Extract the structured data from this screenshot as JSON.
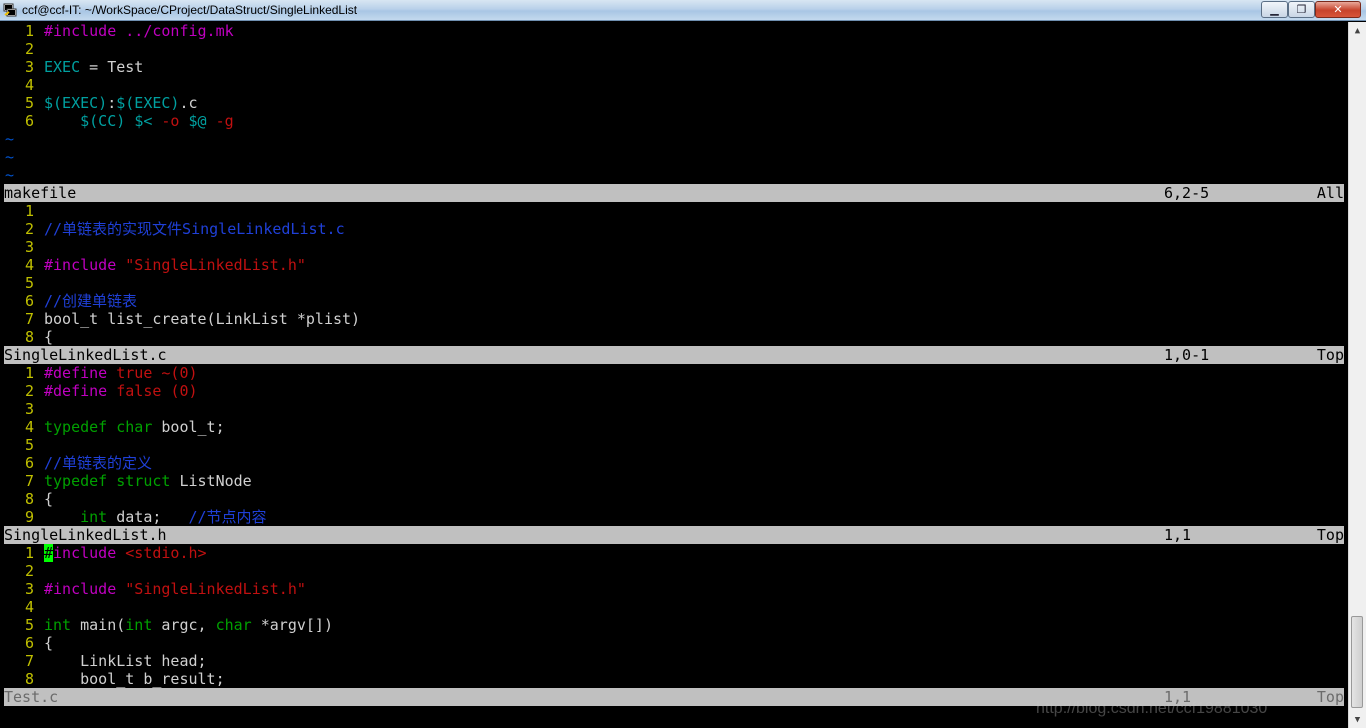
{
  "window": {
    "title": "ccf@ccf-IT: ~/WorkSpace/CProject/DataStruct/SingleLinkedList",
    "minimize_label": "▁",
    "maximize_label": "❐",
    "close_label": "✕",
    "app_icon": "putty-terminal-icon"
  },
  "panes": [
    {
      "lines": [
        {
          "num": "1",
          "segs": [
            {
              "t": "#include ../config.mk",
              "c": "pre"
            }
          ]
        },
        {
          "num": "2",
          "segs": []
        },
        {
          "num": "3",
          "segs": [
            {
              "t": "EXEC",
              "c": "var"
            },
            {
              "t": " = Test",
              "c": "nrm"
            }
          ]
        },
        {
          "num": "4",
          "segs": []
        },
        {
          "num": "5",
          "segs": [
            {
              "t": "$(EXEC)",
              "c": "var"
            },
            {
              "t": ":",
              "c": "nrm"
            },
            {
              "t": "$(EXEC)",
              "c": "var"
            },
            {
              "t": ".c",
              "c": "nrm"
            }
          ]
        },
        {
          "num": "6",
          "segs": [
            {
              "t": "    ",
              "c": "nrm"
            },
            {
              "t": "$(CC)",
              "c": "var"
            },
            {
              "t": " ",
              "c": "nrm"
            },
            {
              "t": "$<",
              "c": "var"
            },
            {
              "t": " ",
              "c": "nrm"
            },
            {
              "t": "-o",
              "c": "str"
            },
            {
              "t": " ",
              "c": "nrm"
            },
            {
              "t": "$@",
              "c": "var"
            },
            {
              "t": " ",
              "c": "nrm"
            },
            {
              "t": "-g",
              "c": "str"
            }
          ]
        }
      ],
      "tildes": 3,
      "status": {
        "name": "makefile",
        "pos": "6,2-5",
        "pct": "All",
        "active": true
      }
    },
    {
      "lines": [
        {
          "num": "1",
          "segs": []
        },
        {
          "num": "2",
          "segs": [
            {
              "t": "//单链表的实现文件SingleLinkedList.c",
              "c": "cmt"
            }
          ]
        },
        {
          "num": "3",
          "segs": []
        },
        {
          "num": "4",
          "segs": [
            {
              "t": "#include ",
              "c": "pre"
            },
            {
              "t": "\"SingleLinkedList.h\"",
              "c": "str"
            }
          ]
        },
        {
          "num": "5",
          "segs": []
        },
        {
          "num": "6",
          "segs": [
            {
              "t": "//创建单链表",
              "c": "cmt"
            }
          ]
        },
        {
          "num": "7",
          "segs": [
            {
              "t": "bool_t list_create(LinkList *plist)",
              "c": "nrm"
            }
          ]
        },
        {
          "num": "8",
          "segs": [
            {
              "t": "{",
              "c": "nrm"
            }
          ]
        }
      ],
      "tildes": 0,
      "status": {
        "name": "SingleLinkedList.c",
        "pos": "1,0-1",
        "pct": "Top",
        "active": true
      }
    },
    {
      "lines": [
        {
          "num": "1",
          "segs": [
            {
              "t": "#define ",
              "c": "pre"
            },
            {
              "t": "true",
              "c": "str"
            },
            {
              "t": " ",
              "c": "nrm"
            },
            {
              "t": "~(0)",
              "c": "str"
            }
          ]
        },
        {
          "num": "2",
          "segs": [
            {
              "t": "#define ",
              "c": "pre"
            },
            {
              "t": "false",
              "c": "str"
            },
            {
              "t": " ",
              "c": "nrm"
            },
            {
              "t": "(0)",
              "c": "str"
            }
          ]
        },
        {
          "num": "3",
          "segs": []
        },
        {
          "num": "4",
          "segs": [
            {
              "t": "typedef",
              "c": "type"
            },
            {
              "t": " ",
              "c": "nrm"
            },
            {
              "t": "char",
              "c": "type"
            },
            {
              "t": " bool_t;",
              "c": "nrm"
            }
          ]
        },
        {
          "num": "5",
          "segs": []
        },
        {
          "num": "6",
          "segs": [
            {
              "t": "//单链表的定义",
              "c": "cmt"
            }
          ]
        },
        {
          "num": "7",
          "segs": [
            {
              "t": "typedef",
              "c": "type"
            },
            {
              "t": " ",
              "c": "nrm"
            },
            {
              "t": "struct",
              "c": "type"
            },
            {
              "t": " ListNode",
              "c": "nrm"
            }
          ]
        },
        {
          "num": "8",
          "segs": [
            {
              "t": "{",
              "c": "nrm"
            }
          ]
        },
        {
          "num": "9",
          "segs": [
            {
              "t": "    ",
              "c": "nrm"
            },
            {
              "t": "int",
              "c": "type"
            },
            {
              "t": " data;   ",
              "c": "nrm"
            },
            {
              "t": "//节点内容",
              "c": "cmt"
            }
          ]
        }
      ],
      "tildes": 0,
      "status": {
        "name": "SingleLinkedList.h",
        "pos": "1,1",
        "pct": "Top",
        "active": true
      }
    },
    {
      "lines": [
        {
          "num": "1",
          "segs": [
            {
              "t": "#",
              "c": "cursor"
            },
            {
              "t": "include ",
              "c": "pre"
            },
            {
              "t": "<stdio.h>",
              "c": "str"
            }
          ]
        },
        {
          "num": "2",
          "segs": []
        },
        {
          "num": "3",
          "segs": [
            {
              "t": "#include ",
              "c": "pre"
            },
            {
              "t": "\"SingleLinkedList.h\"",
              "c": "str"
            }
          ]
        },
        {
          "num": "4",
          "segs": []
        },
        {
          "num": "5",
          "segs": [
            {
              "t": "int",
              "c": "type"
            },
            {
              "t": " main(",
              "c": "nrm"
            },
            {
              "t": "int",
              "c": "type"
            },
            {
              "t": " argc, ",
              "c": "nrm"
            },
            {
              "t": "char",
              "c": "type"
            },
            {
              "t": " *argv[])",
              "c": "nrm"
            }
          ]
        },
        {
          "num": "6",
          "segs": [
            {
              "t": "{",
              "c": "nrm"
            }
          ]
        },
        {
          "num": "7",
          "segs": [
            {
              "t": "    LinkList head;",
              "c": "nrm"
            }
          ]
        },
        {
          "num": "8",
          "segs": [
            {
              "t": "    bool_t b_result;",
              "c": "nrm"
            }
          ]
        }
      ],
      "tildes": 0,
      "status": {
        "name": "Test.c",
        "pos": "1,1",
        "pct": "Top",
        "active": false
      }
    }
  ],
  "scrollbar": {
    "up_icon": "scroll-up-arrow-icon",
    "down_icon": "scroll-down-arrow-icon",
    "up_glyph": "▲",
    "down_glyph": "▼"
  },
  "watermark": "http://blog.csdn.net/ccf19881030"
}
